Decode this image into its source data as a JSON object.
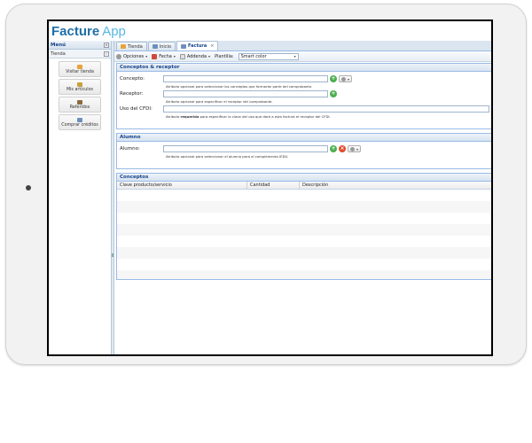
{
  "app": {
    "title_bold": "Facture",
    "title_light": "App"
  },
  "menu": {
    "header": "Menú",
    "collapse_glyph": "«",
    "sub": "Tienda",
    "sub_glyph": "–",
    "items": [
      {
        "label": "Visitar tienda",
        "icon": "store-icon",
        "color": "#e8a33a"
      },
      {
        "label": "Mis artículos",
        "icon": "box-icon",
        "color": "#c9a23b"
      },
      {
        "label": "Referidos",
        "icon": "users-icon",
        "color": "#8c6b3c"
      },
      {
        "label": "Comprar créditos",
        "icon": "credit-card-icon",
        "color": "#6c8fbf"
      }
    ]
  },
  "tabs": [
    {
      "label": "Tienda",
      "icon": "store-icon",
      "color": "#e8a33a",
      "active": false
    },
    {
      "label": "Inicio",
      "icon": "home-icon",
      "color": "#6c8fbf",
      "active": false
    },
    {
      "label": "Factura",
      "icon": "invoice-icon",
      "color": "#6c8fbf",
      "active": true,
      "close": "×"
    }
  ],
  "toolbar": {
    "opciones": "Opciones",
    "fecha": "Fecha",
    "addenda": "Addenda",
    "plantilla_label": "Plantilla:",
    "plantilla_value": "Smart color",
    "caret": "▾"
  },
  "sections": {
    "conceptos_receptor": {
      "title": "Conceptos & receptor",
      "concepto_label": "Concepto:",
      "concepto_help": "Atributo opcional para seleccionar los conceptos que formarán parte del comprobante.",
      "receptor_label": "Receptor:",
      "receptor_help": "Atributo opcional para especificar el receptor del comprobante.",
      "uso_label": "Uso del CFDI:",
      "uso_help_pre": "Atributo ",
      "uso_help_bold": "requerido",
      "uso_help_post": " para especificar la clave del uso que dará a esta factura el receptor del CFDI."
    },
    "alumno": {
      "title": "Alumno",
      "alumno_label": "Alumno:",
      "alumno_help": "Atributo opcional para seleccionar el alumno para el complemento IEDU."
    },
    "conceptos": {
      "title": "Conceptos",
      "columns": [
        "Clave producto/servicio",
        "Cantidad",
        "Descripción"
      ]
    }
  },
  "icons": {
    "add": "+",
    "delete": "×",
    "dropdown": "▾"
  }
}
